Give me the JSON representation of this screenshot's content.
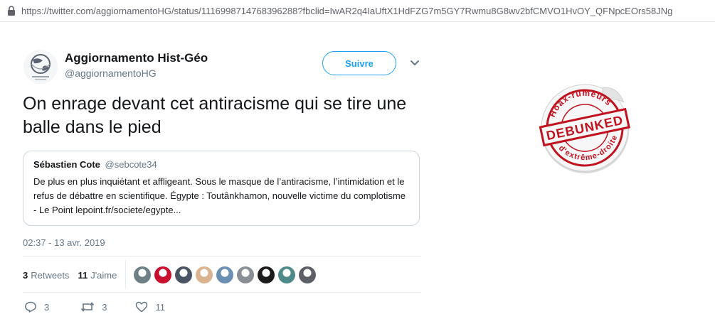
{
  "browser": {
    "url": "https://twitter.com/aggiornamentoHG/status/1116998714768396288?fbclid=IwAR2q4IaUftX1HdFZG7m5GY7Rwmu8G8wv2bfCMVO1HvOY_QFNpcEOrs58JNg",
    "lock_icon": "lock-icon"
  },
  "tweet": {
    "author_name": "Aggiornamento Hist-Géo",
    "author_handle": "@aggiornamentoHG",
    "follow_label": "Suivre",
    "text": "On enrage devant cet antiracisme qui se tire une balle dans le pied",
    "timestamp": "02:37 - 13 avr. 2019"
  },
  "quoted": {
    "name": "Sébastien Cote",
    "handle": "@sebcote34",
    "text": "De plus en plus inquiétant et affligeant. Sous le masque de l’antiracisme, l’intimidation et le refus de débattre en scientifique. Égypte : Toutânkhamon, nouvelle victime du complotisme - Le Point lepoint.fr/societe/egypte..."
  },
  "stats": {
    "retweets_count": "3",
    "retweets_label": "Retweets",
    "likes_count": "11",
    "likes_label": "J'aime"
  },
  "likers": [
    {
      "color": "#6e7f86"
    },
    {
      "color": "#c8102e"
    },
    {
      "color": "#4a5563"
    },
    {
      "color": "#d9b48f"
    },
    {
      "color": "#6b8fb3"
    },
    {
      "color": "#8a8f96"
    },
    {
      "color": "#1b1b1b"
    },
    {
      "color": "#4f8a8b"
    },
    {
      "color": "#5c5f66"
    }
  ],
  "actions": {
    "reply_count": "3",
    "retweet_count": "3",
    "like_count": "11"
  },
  "stamp": {
    "top_text": "Hoax-rumeurs",
    "center_text": "DEBUNKED",
    "bottom_text": "d'extrême-droite",
    "color": "#c1121f"
  },
  "colors": {
    "twitter_blue": "#1da1f2",
    "secondary_text": "#657786"
  }
}
